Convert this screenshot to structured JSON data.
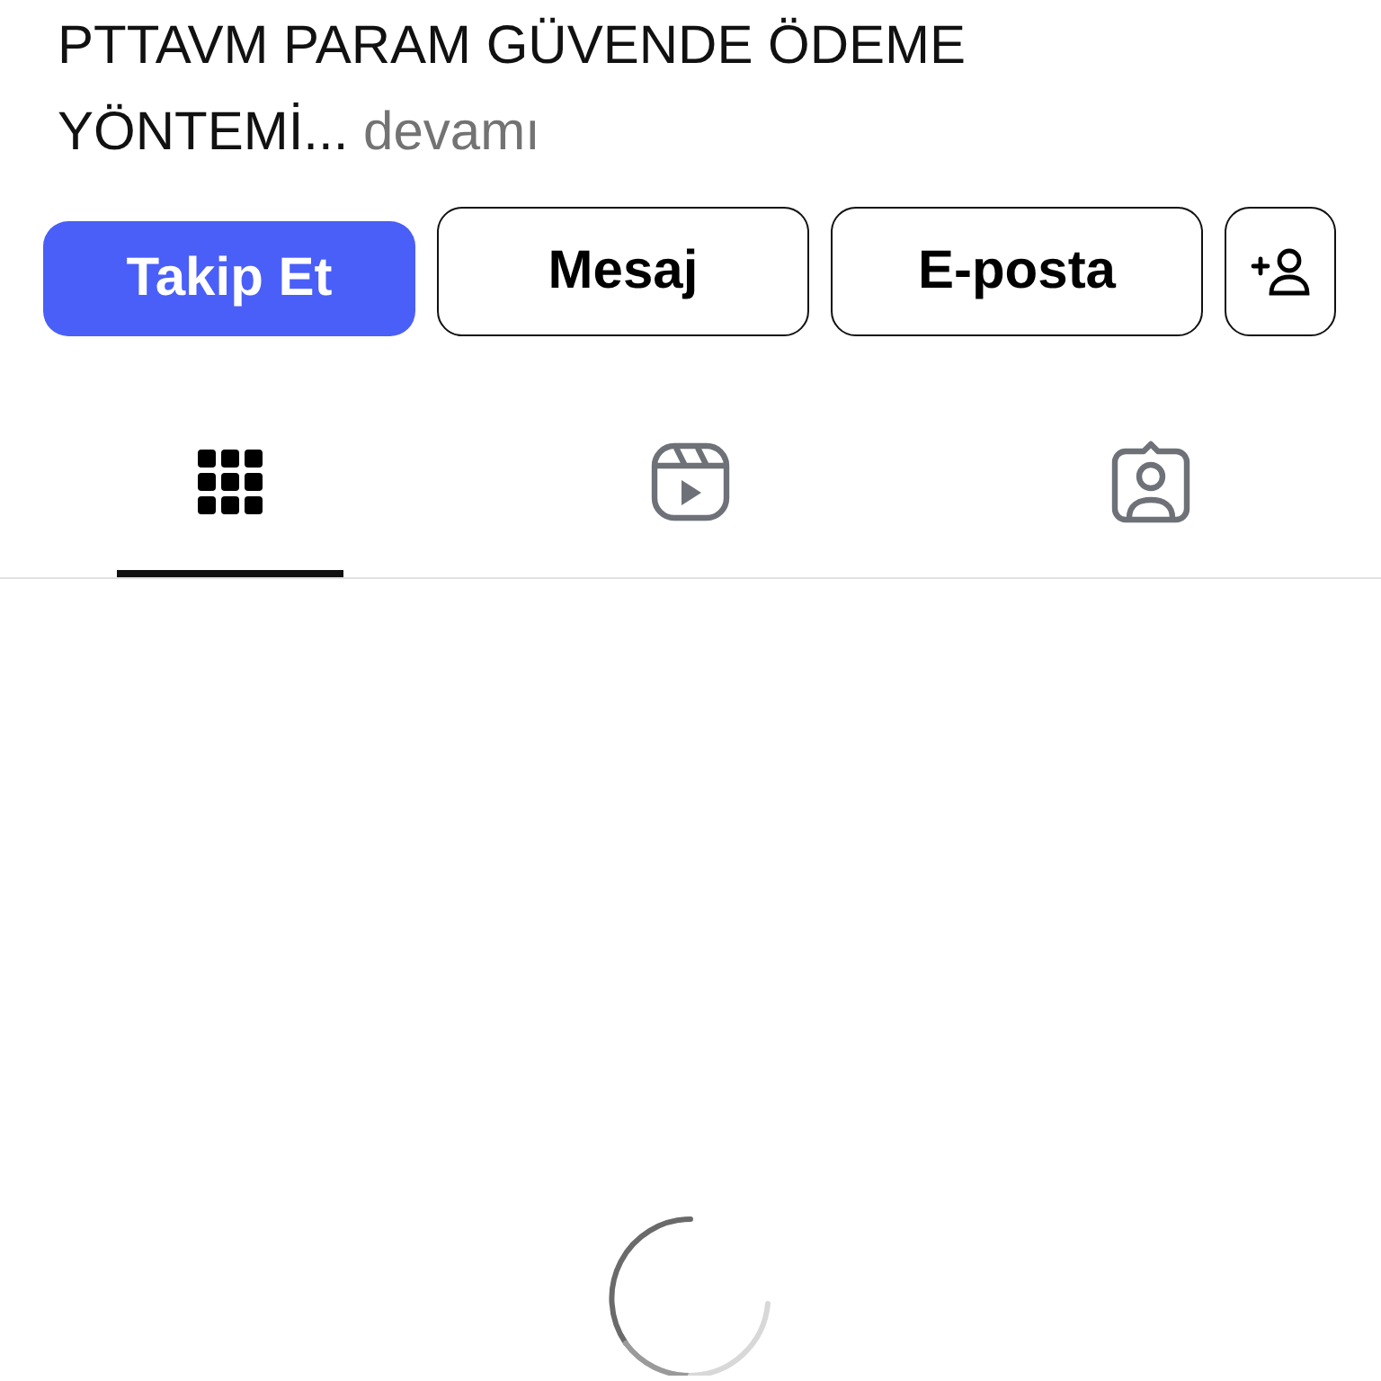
{
  "bio": {
    "text": "PTTAVM PARAM GÜVENDE ÖDEME YÖNTEMİ...",
    "more": "devamı"
  },
  "buttons": [
    {
      "kind": "primary",
      "label": "Takip Et"
    },
    {
      "kind": "outline",
      "label": "Mesaj"
    },
    {
      "kind": "outline",
      "label": "E-posta"
    },
    {
      "kind": "add-person"
    }
  ],
  "tabs": [
    {
      "kind": "grid",
      "selected": true
    },
    {
      "kind": "reels",
      "selected": false
    },
    {
      "kind": "tagged",
      "selected": false
    }
  ]
}
